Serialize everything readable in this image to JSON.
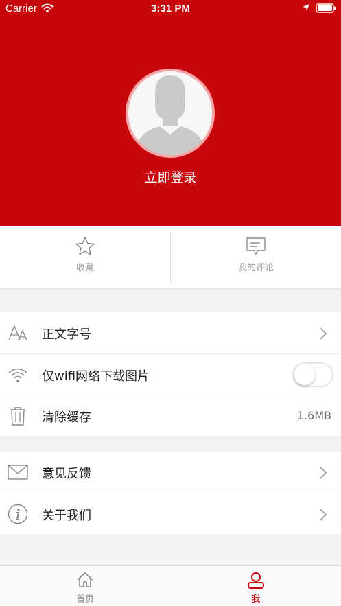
{
  "status_bar": {
    "carrier": "Carrier",
    "time": "3:31 PM"
  },
  "profile": {
    "login_label": "立即登录"
  },
  "quick_actions": [
    {
      "label": "收藏",
      "icon": "star-icon"
    },
    {
      "label": "我的评论",
      "icon": "comment-icon"
    }
  ],
  "settings": {
    "font_size": {
      "label": "正文字号",
      "icon": "font-size-icon"
    },
    "wifi_only": {
      "label": "仅wifi网络下载图片",
      "icon": "wifi-icon",
      "enabled": false
    },
    "clear_cache": {
      "label": "清除缓存",
      "icon": "trash-icon",
      "value": "1.6MB"
    }
  },
  "about": {
    "feedback": {
      "label": "意见反馈",
      "icon": "mail-icon"
    },
    "about_us": {
      "label": "关于我们",
      "icon": "info-icon"
    }
  },
  "tabbar": {
    "home": {
      "label": "首页",
      "icon": "home-icon",
      "color": "#888888"
    },
    "me": {
      "label": "我",
      "icon": "user-icon",
      "color": "#c8070d",
      "active": true
    }
  },
  "colors": {
    "brand": "#c8070d",
    "background": "#f2f2f2"
  }
}
